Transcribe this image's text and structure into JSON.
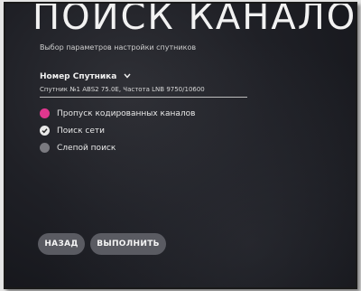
{
  "title": "ПОИСК КАНАЛОВ",
  "subtitle": "Выбор параметров настройки спутников",
  "satellite": {
    "label": "Номер Спутника",
    "value": "Спутник №1 ABS2 75.0E, Частота LNB 9750/10600"
  },
  "options": [
    {
      "label": "Пропуск кодированных каналов",
      "state": "focused",
      "color": "#e0378f"
    },
    {
      "label": "Поиск сети",
      "state": "checked",
      "color": "#e9e9e9"
    },
    {
      "label": "Слепой поиск",
      "state": "unchecked",
      "color": "#7a7a80"
    }
  ],
  "buttons": {
    "back_label": "НАЗАД",
    "run_label": "ВЫПОЛНИТЬ"
  },
  "icons": {
    "dropdown": "chevron-down-icon",
    "check": "checkmark-icon"
  }
}
